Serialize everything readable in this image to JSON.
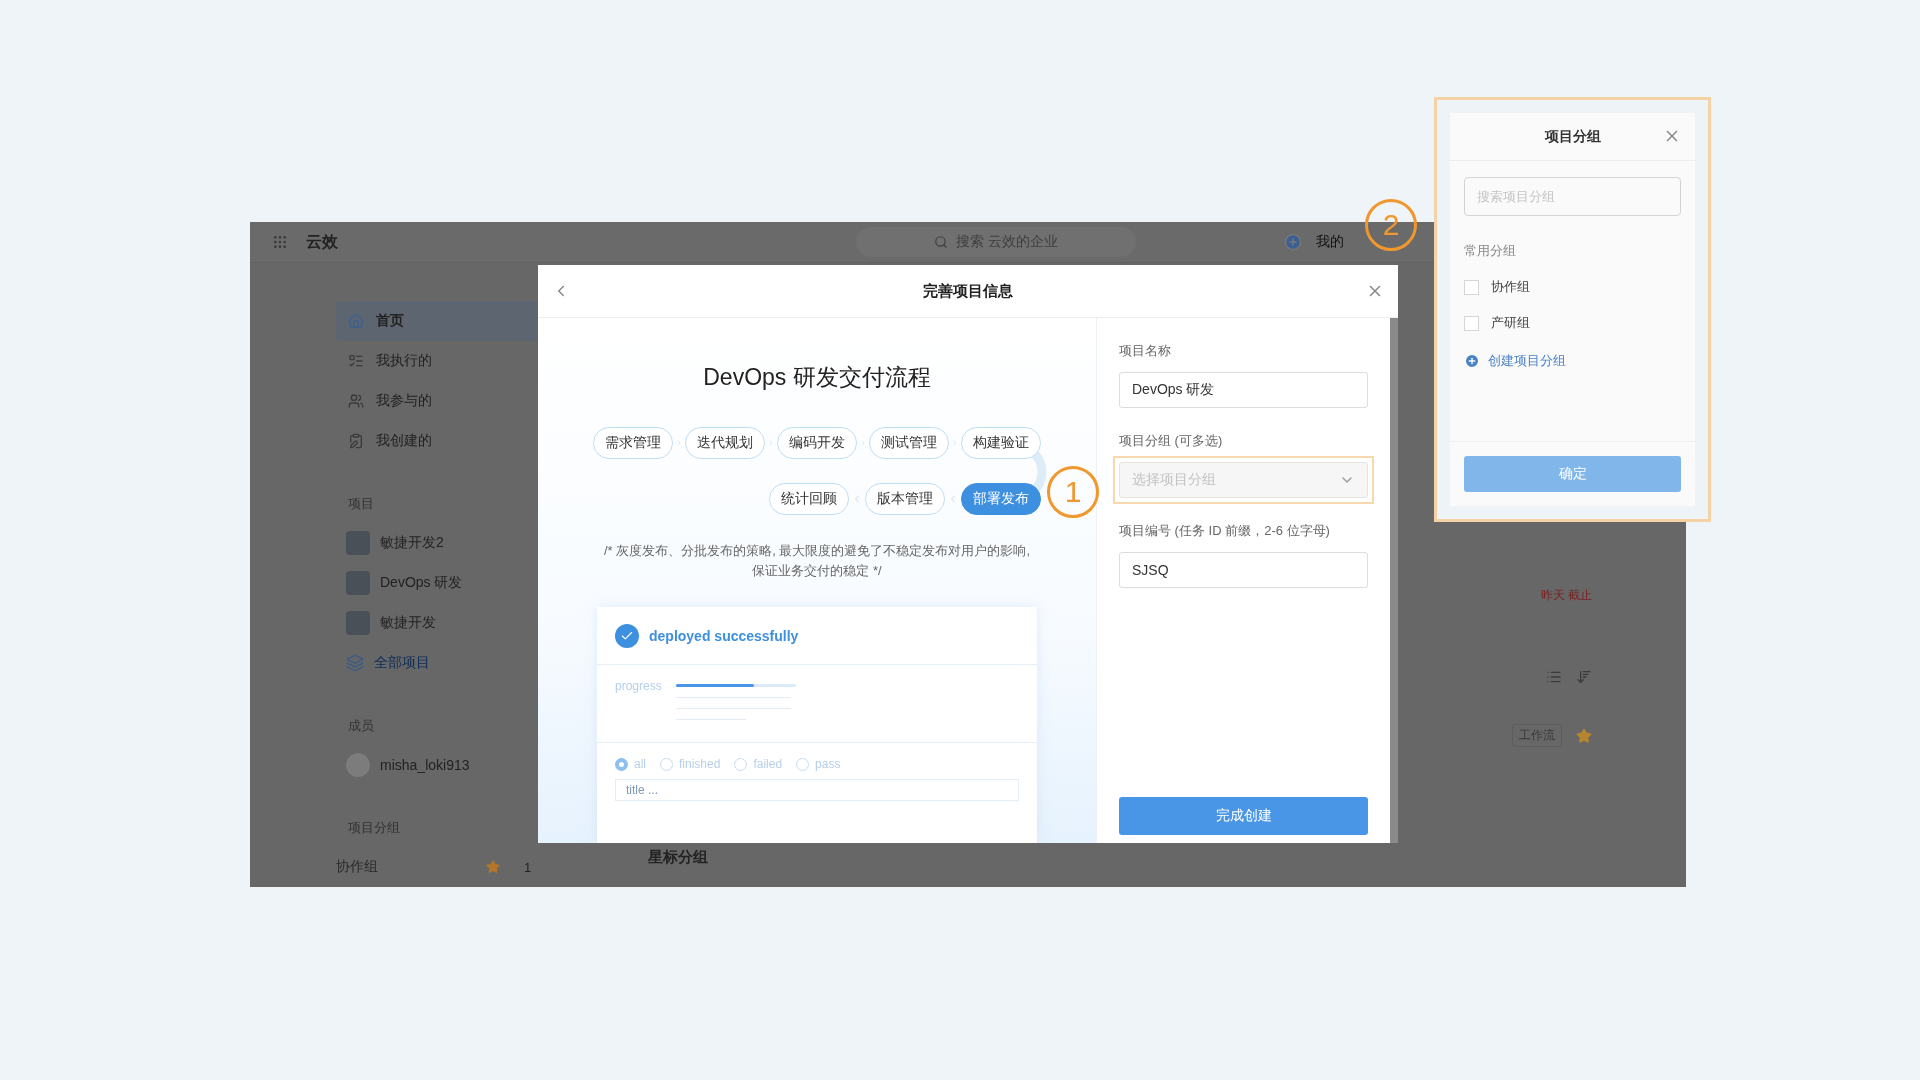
{
  "app": {
    "name": "云效",
    "search_placeholder": "搜索 云效的企业",
    "user_menu": "我的"
  },
  "sidebar": {
    "nav": [
      {
        "label": "首页",
        "selected": true
      },
      {
        "label": "我执行的",
        "selected": false
      },
      {
        "label": "我参与的",
        "selected": false
      },
      {
        "label": "我创建的",
        "selected": false
      }
    ],
    "projects_heading": "项目",
    "projects": [
      {
        "name": "敏捷开发2"
      },
      {
        "name": "DevOps 研发"
      },
      {
        "name": "敏捷开发"
      }
    ],
    "all_projects": "全部项目",
    "members_heading": "成员",
    "members": [
      {
        "name": "misha_loki913"
      }
    ],
    "groups_heading": "项目分组",
    "groups": [
      {
        "name": "协作组",
        "starred": true,
        "count": "1"
      }
    ]
  },
  "main": {
    "due": "昨天 截止",
    "tag": "工作流",
    "starred": true,
    "starred_groups_heading": "星标分组"
  },
  "modal": {
    "title": "完善项目信息",
    "flow_title": "DevOps 研发交付流程",
    "steps_top": [
      {
        "label": "需求管理",
        "selected": false
      },
      {
        "label": "迭代规划",
        "selected": false
      },
      {
        "label": "编码开发",
        "selected": false
      },
      {
        "label": "测试管理",
        "selected": false
      },
      {
        "label": "构建验证",
        "selected": false
      }
    ],
    "steps_bottom": [
      {
        "label": "统计回顾",
        "selected": false
      },
      {
        "label": "版本管理",
        "selected": false
      },
      {
        "label": "部署发布",
        "selected": true
      }
    ],
    "description": "/* 灰度发布、分批发布的策略, 最大限度的避免了不稳定发布对用户的影响, 保证业务交付的稳定 */",
    "preview": {
      "status": "deployed successfully",
      "progress_label": "progress",
      "level": 0.65,
      "filters": [
        {
          "label": "all",
          "selected": true
        },
        {
          "label": "finished",
          "selected": false
        },
        {
          "label": "failed",
          "selected": false
        },
        {
          "label": "pass",
          "selected": false
        }
      ],
      "search_placeholder": "title ..."
    },
    "fields": [
      {
        "kind": "text",
        "label": "项目名称",
        "value": "DevOps 研发",
        "highlighted": false
      },
      {
        "kind": "select",
        "label": "项目分组 (可多选)",
        "placeholder": "选择项目分组",
        "highlighted": true
      },
      {
        "kind": "text",
        "label": "项目编号 (任务 ID 前缀，2-6 位字母)",
        "value": "SJSQ",
        "highlighted": false
      }
    ],
    "submit": "完成创建"
  },
  "popup": {
    "title": "项目分组",
    "search_placeholder": "搜索项目分组",
    "section": "常用分组",
    "options": [
      {
        "label": "协作组",
        "checked": false
      },
      {
        "label": "产研组",
        "checked": false
      }
    ],
    "create_link": "创建项目分组",
    "confirm": "确定",
    "confirm_disabled": true,
    "highlighted": true
  },
  "annotations": [
    {
      "label": "1"
    },
    {
      "label": "2"
    }
  ]
}
